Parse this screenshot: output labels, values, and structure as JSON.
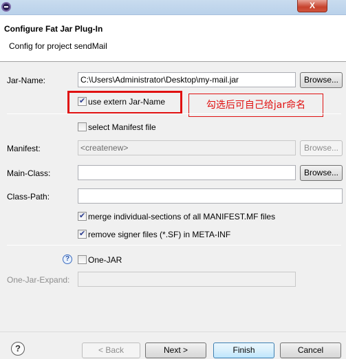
{
  "window": {
    "close_label": "X"
  },
  "header": {
    "title": "Configure Fat Jar Plug-In",
    "description": "Config for project sendMail"
  },
  "form": {
    "jar_name_label": "Jar-Name:",
    "jar_name_value": "C:\\Users\\Administrator\\Desktop\\my-mail.jar",
    "browse_label": "Browse...",
    "use_extern_label": "use extern Jar-Name",
    "select_manifest_label": "select Manifest file",
    "manifest_label": "Manifest:",
    "manifest_value": "<createnew>",
    "main_class_label": "Main-Class:",
    "main_class_value": "",
    "class_path_label": "Class-Path:",
    "class_path_value": "",
    "merge_label": "merge individual-sections of all MANIFEST.MF files",
    "remove_signer_label": "remove signer files (*.SF) in META-INF",
    "one_jar_label": "One-JAR",
    "one_jar_expand_label": "One-Jar-Expand:",
    "one_jar_expand_value": ""
  },
  "annotation": {
    "text": "勾选后可自己给jar命名"
  },
  "footer": {
    "back_label": "< Back",
    "next_label": "Next >",
    "finish_label": "Finish",
    "cancel_label": "Cancel"
  },
  "icons": {
    "help": "?"
  },
  "colors": {
    "annotation": "#e01010",
    "header_bg": "#ffffff"
  }
}
